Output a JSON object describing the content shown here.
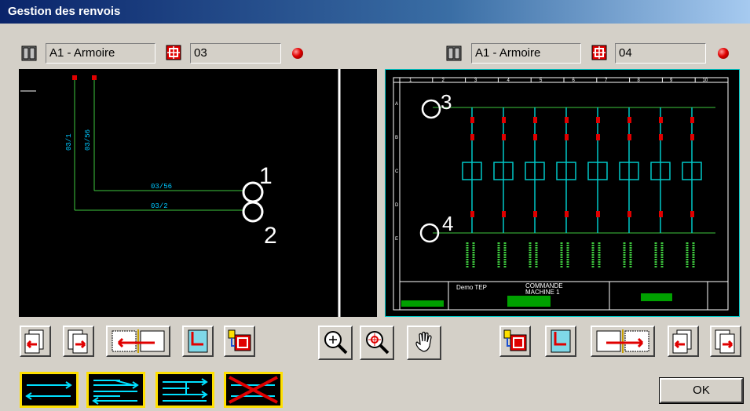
{
  "window": {
    "title": "Gestion des renvois"
  },
  "left": {
    "cabinet": "A1 - Armoire",
    "folio": "03"
  },
  "right": {
    "cabinet": "A1 - Armoire",
    "folio": "04"
  },
  "left_view": {
    "wire_label_a": "03/1",
    "wire_label_b": "03/56",
    "wire_label_c": "03/56",
    "wire_label_d": "03/2",
    "marker_1": "1",
    "marker_2": "2"
  },
  "right_view": {
    "marker_3": "3",
    "marker_4": "4",
    "title_left": "Demo TEP",
    "title_center_1": "COMMANDE",
    "title_center_2": "MACHINE 1",
    "cols": [
      "1",
      "2",
      "3",
      "4",
      "5",
      "6",
      "7",
      "8",
      "9",
      "10"
    ],
    "rows": [
      "A",
      "B",
      "C",
      "D",
      "E"
    ]
  },
  "buttons": {
    "ok": "OK"
  },
  "icons": {
    "cabinet": "cabinet-icon",
    "folio": "folio-icon",
    "status": "status-led-icon"
  }
}
